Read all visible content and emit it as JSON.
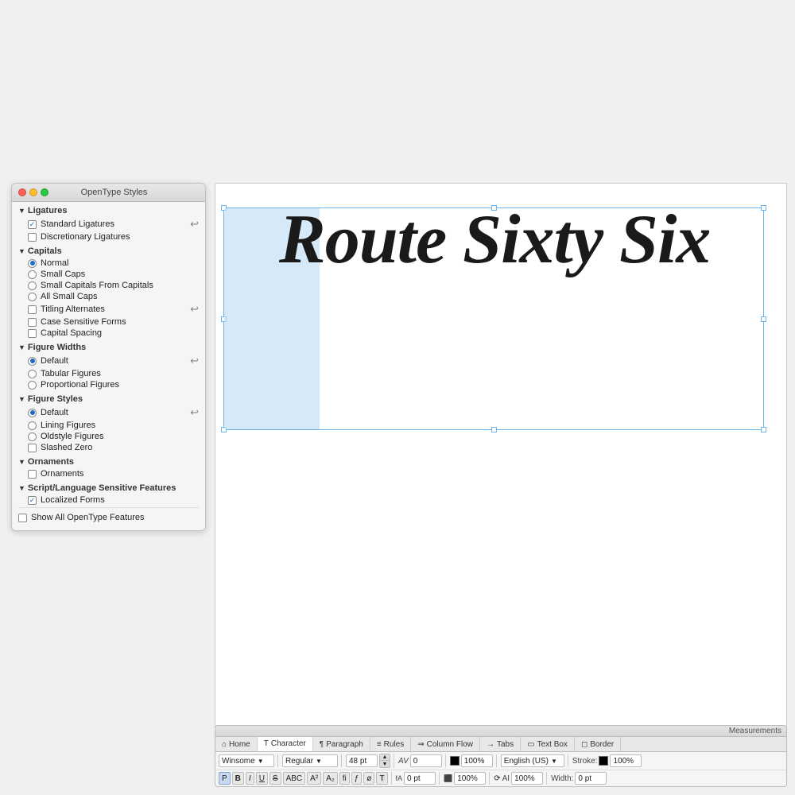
{
  "panel": {
    "title": "OpenType Styles",
    "sections": {
      "ligatures": {
        "label": "Ligatures",
        "options": [
          {
            "id": "standard-ligatures",
            "label": "Standard Ligatures",
            "type": "checkbox",
            "checked": true,
            "hasIcon": true
          },
          {
            "id": "discretionary-ligatures",
            "label": "Discretionary Ligatures",
            "type": "checkbox",
            "checked": false,
            "hasIcon": false
          }
        ]
      },
      "capitals": {
        "label": "Capitals",
        "options": [
          {
            "id": "normal",
            "label": "Normal",
            "type": "radio",
            "checked": true,
            "hasIcon": false
          },
          {
            "id": "small-caps",
            "label": "Small Caps",
            "type": "radio",
            "checked": false,
            "hasIcon": false
          },
          {
            "id": "small-caps-from-capitals",
            "label": "Small Capitals From Capitals",
            "type": "radio",
            "checked": false,
            "hasIcon": false
          },
          {
            "id": "all-small-caps",
            "label": "All Small Caps",
            "type": "radio",
            "checked": false,
            "hasIcon": false
          },
          {
            "id": "titling-alternates",
            "label": "Titling Alternates",
            "type": "checkbox",
            "checked": false,
            "hasIcon": true
          },
          {
            "id": "case-sensitive-forms",
            "label": "Case Sensitive Forms",
            "type": "checkbox",
            "checked": false,
            "hasIcon": false
          },
          {
            "id": "capital-spacing",
            "label": "Capital Spacing",
            "type": "checkbox",
            "checked": false,
            "hasIcon": false
          }
        ]
      },
      "figure_widths": {
        "label": "Figure Widths",
        "options": [
          {
            "id": "fw-default",
            "label": "Default",
            "type": "radio",
            "checked": true,
            "hasIcon": true
          },
          {
            "id": "tabular-figures",
            "label": "Tabular Figures",
            "type": "radio",
            "checked": false,
            "hasIcon": false
          },
          {
            "id": "proportional-figures",
            "label": "Proportional Figures",
            "type": "radio",
            "checked": false,
            "hasIcon": false
          }
        ]
      },
      "figure_styles": {
        "label": "Figure Styles",
        "options": [
          {
            "id": "fs-default",
            "label": "Default",
            "type": "radio",
            "checked": true,
            "hasIcon": true
          },
          {
            "id": "lining-figures",
            "label": "Lining Figures",
            "type": "radio",
            "checked": false,
            "hasIcon": false
          },
          {
            "id": "oldstyle-figures",
            "label": "Oldstyle Figures",
            "type": "radio",
            "checked": false,
            "hasIcon": false
          },
          {
            "id": "slashed-zero",
            "label": "Slashed Zero",
            "type": "checkbox",
            "checked": false,
            "hasIcon": false
          }
        ]
      },
      "ornaments": {
        "label": "Ornaments",
        "options": [
          {
            "id": "ornaments",
            "label": "Ornaments",
            "type": "checkbox",
            "checked": false,
            "hasIcon": false
          }
        ]
      },
      "script_language": {
        "label": "Script/Language Sensitive Features",
        "options": [
          {
            "id": "localized-forms",
            "label": "Localized Forms",
            "type": "checkbox",
            "checked": true,
            "hasIcon": false
          }
        ]
      }
    },
    "show_all_label": "Show All OpenType Features"
  },
  "canvas": {
    "text": "Route Sixty Six"
  },
  "measurements": {
    "title": "Measurements",
    "tabs": [
      {
        "id": "home",
        "label": "Home",
        "icon": "house"
      },
      {
        "id": "character",
        "label": "Character",
        "icon": "T"
      },
      {
        "id": "paragraph",
        "label": "Paragraph",
        "icon": "para"
      },
      {
        "id": "rules",
        "label": "Rules",
        "icon": "rules"
      },
      {
        "id": "column-flow",
        "label": "Column Flow",
        "icon": "columns"
      },
      {
        "id": "tabs",
        "label": "Tabs",
        "icon": "arrow"
      },
      {
        "id": "text-box",
        "label": "Text Box",
        "icon": "box"
      },
      {
        "id": "border",
        "label": "Border",
        "icon": "border"
      }
    ],
    "row1": {
      "font_name": "Winsome",
      "font_style": "Regular",
      "font_size": "48 pt",
      "kern": "0",
      "opacity": "100%",
      "language": "English (US)",
      "stroke_label": "Stroke:",
      "stroke_value": "100%"
    },
    "row2": {
      "para_btn": "P",
      "bold": "B",
      "italic": "I",
      "underline": "U",
      "strikethrough": "S",
      "abc_caps": "ABC",
      "super": "A²",
      "sub": "A₂",
      "fi": "fi",
      "fl": "ƒ",
      "oe": "ø",
      "shadow": "T",
      "baseline": "fA",
      "baseline_val": "0 pt",
      "scale_h": "100%",
      "rotate_icon": "⟳",
      "ai_label": "AI",
      "ai_val": "100%",
      "width_label": "Width:",
      "width_val": "0 pt"
    }
  }
}
